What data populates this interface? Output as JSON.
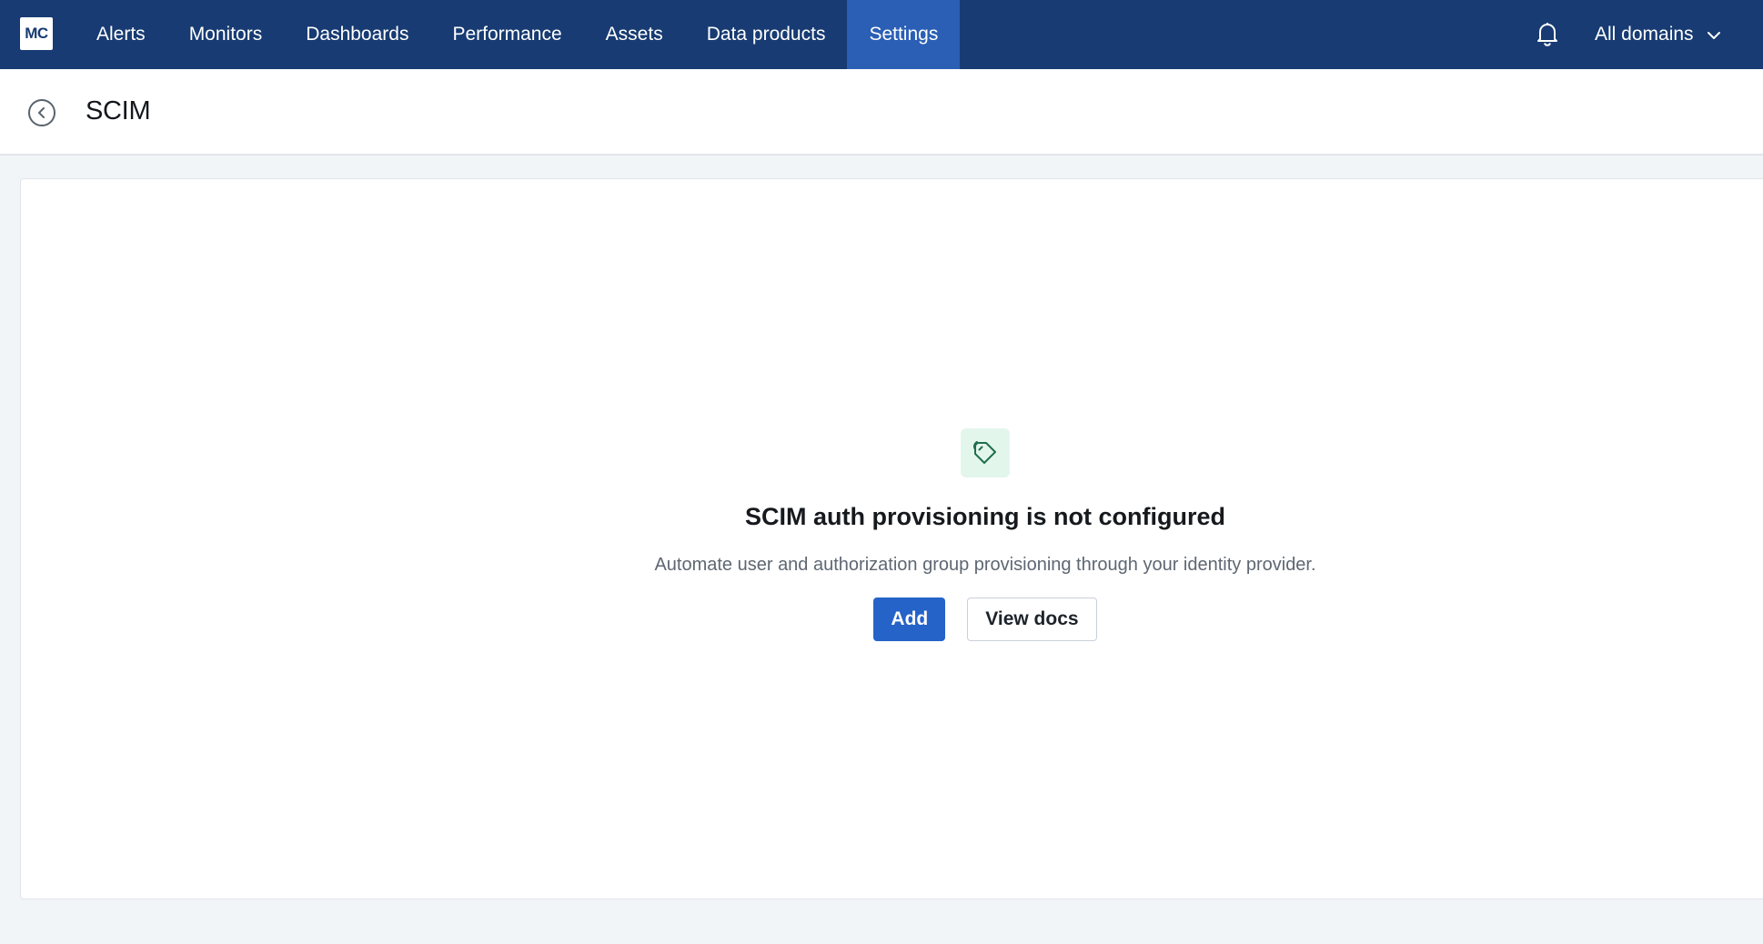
{
  "topnav": {
    "logo_text": "MC",
    "items": [
      {
        "label": "Alerts",
        "active": false
      },
      {
        "label": "Monitors",
        "active": false
      },
      {
        "label": "Dashboards",
        "active": false
      },
      {
        "label": "Performance",
        "active": false
      },
      {
        "label": "Assets",
        "active": false
      },
      {
        "label": "Data products",
        "active": false
      },
      {
        "label": "Settings",
        "active": true
      }
    ],
    "notifications_icon": "bell-icon",
    "domain_selector": {
      "value": "All domains",
      "icon": "chevron-down-icon"
    }
  },
  "header": {
    "back_icon": "back-circle-icon",
    "title": "SCIM"
  },
  "empty_state": {
    "icon": "tag-icon",
    "title": "SCIM auth provisioning is not configured",
    "description": "Automate user and authorization group provisioning through your identity provider.",
    "primary_button": "Add",
    "secondary_button": "View docs"
  },
  "colors": {
    "nav_background": "#173b72",
    "nav_active": "#2a5fb5",
    "primary_button": "#2563c9",
    "icon_tile": "#e3f6ec",
    "icon_stroke": "#1f6e4a"
  }
}
